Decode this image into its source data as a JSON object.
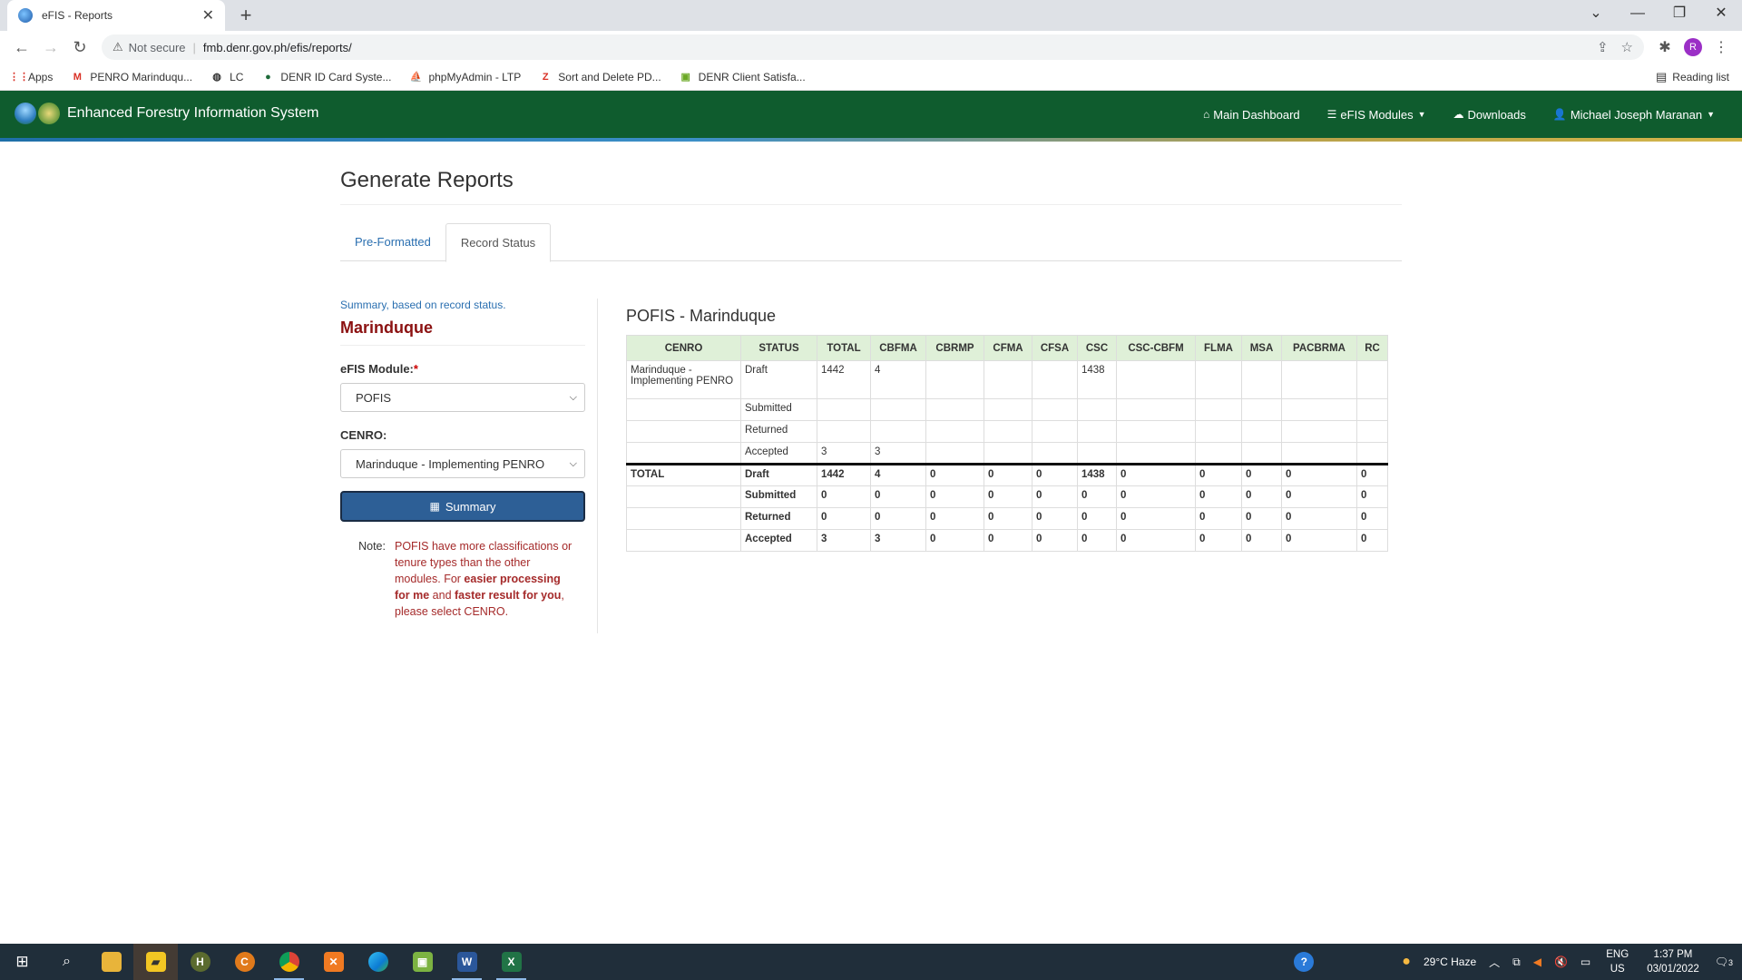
{
  "browser": {
    "tab_title": "eFIS - Reports",
    "new_tab": "+",
    "security": "Not secure",
    "url": "fmb.denr.gov.ph/efis/reports/",
    "bookmarks": [
      "Apps",
      "PENRO Marinduqu...",
      "LC",
      "DENR ID Card Syste...",
      "phpMyAdmin - LTP",
      "Sort and Delete PD...",
      "DENR Client Satisfa..."
    ],
    "reading_list": "Reading list",
    "profile_initial": "R"
  },
  "app": {
    "brand": "Enhanced Forestry Information System",
    "nav": {
      "dashboard": "Main Dashboard",
      "modules": "eFIS Modules",
      "downloads": "Downloads",
      "user": "Michael Joseph Maranan"
    }
  },
  "page": {
    "title": "Generate Reports",
    "tabs": [
      "Pre-Formatted",
      "Record Status"
    ],
    "summary_text": "Summary, based on record status.",
    "region": "Marinduque",
    "module_label": "eFIS Module:",
    "required_mark": "*",
    "module_value": "POFIS",
    "cenro_label": "CENRO:",
    "cenro_value": "Marinduque - Implementing PENRO",
    "summary_button": "Summary",
    "note_label": "Note:",
    "note_part1": "POFIS have more classifications or tenure types than the other modules. For ",
    "note_bold1": "easier processing for me",
    "note_part2": " and ",
    "note_bold2": "faster result for you",
    "note_part3": ", please select CENRO."
  },
  "table": {
    "title": "POFIS - Marinduque",
    "headers": [
      "CENRO",
      "STATUS",
      "TOTAL",
      "CBFMA",
      "CBRMP",
      "CFMA",
      "CFSA",
      "CSC",
      "CSC-CBFM",
      "FLMA",
      "MSA",
      "PACBRMA",
      "RC"
    ],
    "rows": [
      [
        "Marinduque - Implementing PENRO",
        "Draft",
        "1442",
        "4",
        "",
        "",
        "",
        "1438",
        "",
        "",
        "",
        "",
        ""
      ],
      [
        "",
        "Submitted",
        "",
        "",
        "",
        "",
        "",
        "",
        "",
        "",
        "",
        "",
        ""
      ],
      [
        "",
        "Returned",
        "",
        "",
        "",
        "",
        "",
        "",
        "",
        "",
        "",
        "",
        ""
      ],
      [
        "",
        "Accepted",
        "3",
        "3",
        "",
        "",
        "",
        "",
        "",
        "",
        "",
        "",
        ""
      ]
    ],
    "totals": [
      [
        "TOTAL",
        "Draft",
        "1442",
        "4",
        "0",
        "0",
        "0",
        "1438",
        "0",
        "0",
        "0",
        "0",
        "0"
      ],
      [
        "",
        "Submitted",
        "0",
        "0",
        "0",
        "0",
        "0",
        "0",
        "0",
        "0",
        "0",
        "0",
        "0"
      ],
      [
        "",
        "Returned",
        "0",
        "0",
        "0",
        "0",
        "0",
        "0",
        "0",
        "0",
        "0",
        "0",
        "0"
      ],
      [
        "",
        "Accepted",
        "3",
        "3",
        "0",
        "0",
        "0",
        "0",
        "0",
        "0",
        "0",
        "0",
        "0"
      ]
    ]
  },
  "taskbar": {
    "weather": "29°C  Haze",
    "lang": "ENG",
    "region": "US",
    "time": "1:37 PM",
    "date": "03/01/2022",
    "notifications": "3"
  }
}
